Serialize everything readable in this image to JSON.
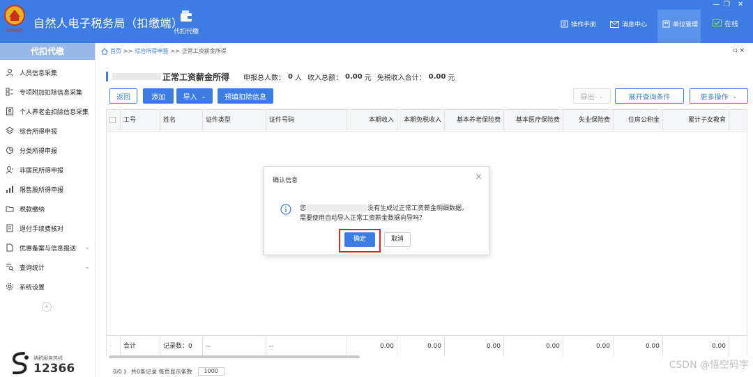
{
  "app": {
    "title": "自然人电子税务局（扣缴端）",
    "emblem_text": "中国税务"
  },
  "topnav": {
    "agent_label": "代扣代缴"
  },
  "topbar_right": {
    "manual": "操作手册",
    "messages": "消息中心",
    "unit_mgmt": "单位管理",
    "online": "在线"
  },
  "sidebar": {
    "header": "代扣代缴",
    "items": [
      {
        "label": "人员信息采集"
      },
      {
        "label": "专项附加扣除信息采集"
      },
      {
        "label": "个人养老金扣除信息采集"
      },
      {
        "label": "综合所得申报"
      },
      {
        "label": "分类所得申报"
      },
      {
        "label": "非居民所得申报"
      },
      {
        "label": "限售股所得申报"
      },
      {
        "label": "税款缴纳"
      },
      {
        "label": "退付手续费核对"
      },
      {
        "label": "优惠备案与信息报送"
      },
      {
        "label": "查询统计"
      },
      {
        "label": "系统设置"
      }
    ],
    "collapse": "«",
    "hotline_label": "纳税服务热线",
    "hotline_number": "12366"
  },
  "breadcrumb": {
    "home": "首页",
    "sep1": ">>",
    "level1": "综合所得申报",
    "sep2": ">>",
    "current": "正常工资薪金所得",
    "close": "▫ ×"
  },
  "summary": {
    "title": "正常工资薪金所得",
    "people_label": "申报总人数：",
    "people_value": "0",
    "people_unit": "人",
    "income_label": "收入总额：",
    "income_value": "0.00",
    "income_unit": "元",
    "exempt_label": "免税收入合计：",
    "exempt_value": "0.00",
    "exempt_unit": "元"
  },
  "toolbar": {
    "back": "返回",
    "add": "添加",
    "import": "导入",
    "prefill": "预填扣除信息",
    "export": "导出",
    "expand_query": "展开查询条件",
    "more": "更多操作"
  },
  "table": {
    "columns": [
      "工号",
      "姓名",
      "证件类型",
      "证件号码",
      "本期收入",
      "本期免税收入",
      "基本养老保险费",
      "基本医疗保险费",
      "失业保险费",
      "住房公积金",
      "累计子女教育"
    ],
    "footer": {
      "total_label": "合计",
      "record_count": "记录数：0",
      "dash1": "--",
      "dash2": "--",
      "values": [
        "0.00",
        "0.00",
        "0.00",
        "0.00",
        "0.00",
        "0.00",
        "0.00"
      ]
    }
  },
  "pager": {
    "text": "0/0 》 共0条记录  每页显示条数",
    "page_size": "1000"
  },
  "dialog": {
    "title": "确认信息",
    "close": "×",
    "msg_prefix": "您",
    "msg_suffix": "没有生成过正常工资薪金明细数据。",
    "msg_line2": "需要使用自动导入正常工资薪金数据向导吗？",
    "ok": "确定",
    "cancel": "取消"
  },
  "watermark": "CSDN @悟空码字",
  "colors": {
    "topbar": "#3d7de3",
    "primary": "#3d7de3",
    "highlight": "#d9262c"
  }
}
